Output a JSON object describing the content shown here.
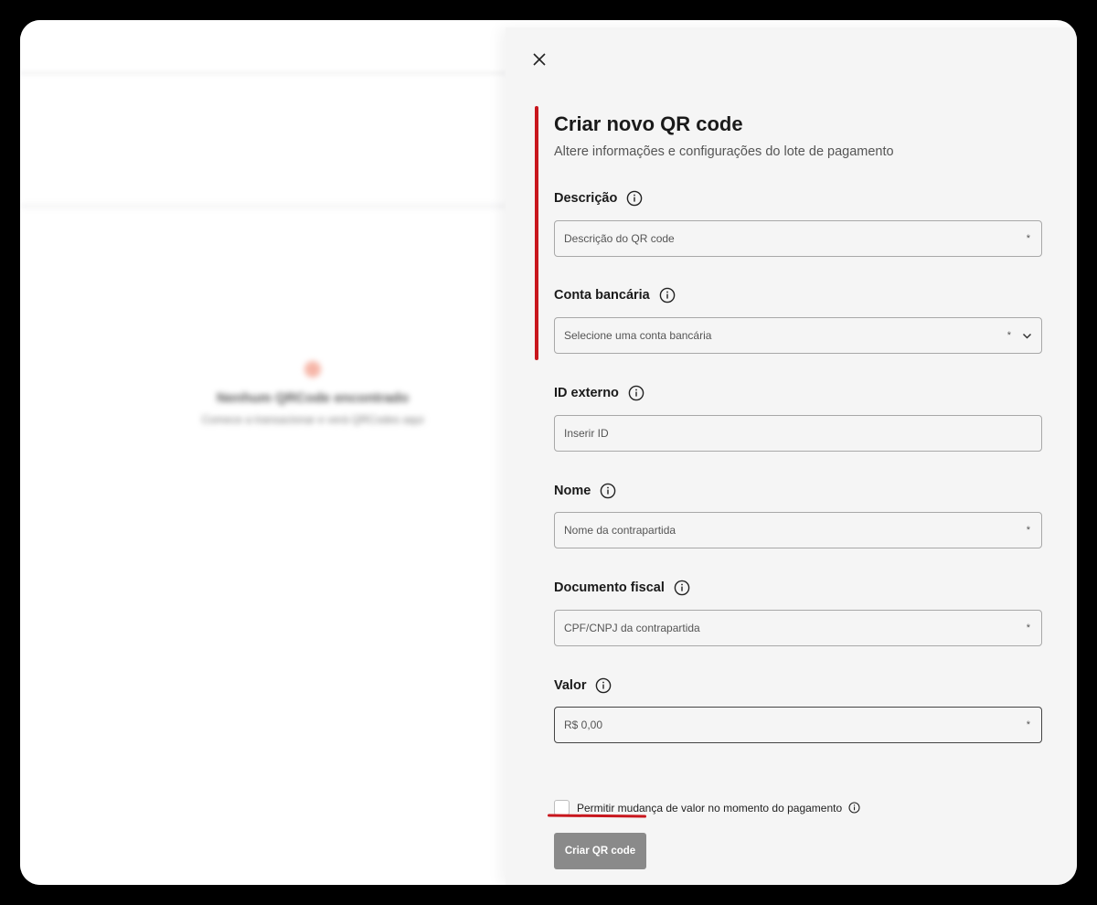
{
  "background": {
    "empty_title": "Nenhum QRCode encontrado",
    "empty_subtitle": "Comece a transacionar e verá QRCodes aqui"
  },
  "panel": {
    "title": "Criar novo QR code",
    "subtitle": "Altere informações e configurações do lote de pagamento",
    "fields": {
      "descricao": {
        "label": "Descrição",
        "placeholder": "Descrição do QR code",
        "required": "*"
      },
      "conta": {
        "label": "Conta bancária",
        "placeholder": "Selecione uma conta bancária",
        "required": "*"
      },
      "id_externo": {
        "label": "ID externo",
        "placeholder": "Inserir ID"
      },
      "nome": {
        "label": "Nome",
        "placeholder": "Nome da contrapartida",
        "required": "*"
      },
      "documento": {
        "label": "Documento fiscal",
        "placeholder": "CPF/CNPJ da contrapartida",
        "required": "*"
      },
      "valor": {
        "label": "Valor",
        "placeholder": "R$ 0,00",
        "required": "*"
      }
    },
    "checkbox_label": "Permitir mudança de valor no momento do pagamento",
    "submit_label": "Criar QR code"
  },
  "colors": {
    "annotation_red": "#c8161d",
    "button_disabled": "#8a8a8a",
    "panel_bg": "#f5f5f5"
  },
  "icons": [
    "close-icon",
    "info-icon",
    "chevron-down-icon"
  ]
}
